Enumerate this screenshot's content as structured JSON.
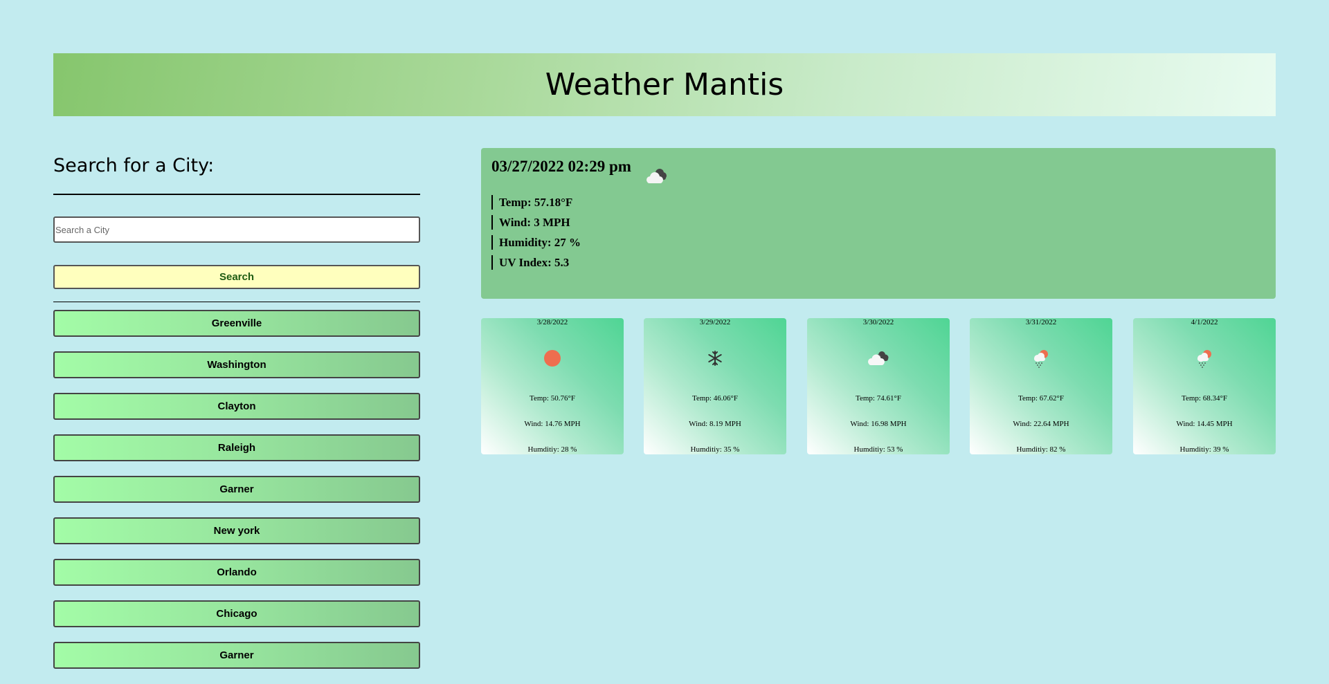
{
  "header": {
    "title": "Weather Mantis"
  },
  "search": {
    "heading": "Search for a City:",
    "placeholder": "Search a City",
    "button_label": "Search"
  },
  "history": [
    "Greenville",
    "Washington",
    "Clayton",
    "Raleigh",
    "Garner",
    "New york",
    "Orlando",
    "Chicago",
    "Garner"
  ],
  "current": {
    "datetime": "03/27/2022 02:29 pm",
    "icon": "cloud-icon",
    "temp": "Temp: 57.18°F",
    "wind": "Wind: 3 MPH",
    "humidity": "Humidity: 27 %",
    "uv": "UV Index: 5.3"
  },
  "forecast": [
    {
      "date": "3/28/2022",
      "icon": "sun-icon",
      "temp": "Temp: 50.76°F",
      "wind": "Wind: 14.76 MPH",
      "humidity": "Humditiy: 28 %"
    },
    {
      "date": "3/29/2022",
      "icon": "snowflake-icon",
      "temp": "Temp: 46.06°F",
      "wind": "Wind: 8.19 MPH",
      "humidity": "Humditiy: 35 %"
    },
    {
      "date": "3/30/2022",
      "icon": "cloud-icon",
      "temp": "Temp: 74.61°F",
      "wind": "Wind: 16.98 MPH",
      "humidity": "Humditiy: 53 %"
    },
    {
      "date": "3/31/2022",
      "icon": "sun-rain-icon",
      "temp": "Temp: 67.62°F",
      "wind": "Wind: 22.64 MPH",
      "humidity": "Humditiy: 82 %"
    },
    {
      "date": "4/1/2022",
      "icon": "sun-rain-icon",
      "temp": "Temp: 68.34°F",
      "wind": "Wind: 14.45 MPH",
      "humidity": "Humditiy: 39 %"
    }
  ],
  "colors": {
    "page_bg": "#c2ebef",
    "current_bg": "#83c991",
    "search_btn_bg": "#ffffbe",
    "search_btn_text": "#1d5b12",
    "sun": "#ee6e4f"
  }
}
